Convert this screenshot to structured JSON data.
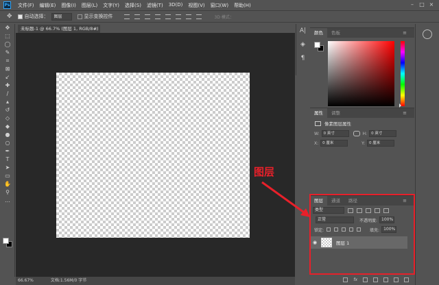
{
  "app": {
    "logo": "Ps"
  },
  "menu": [
    "文件(F)",
    "编辑(E)",
    "图像(I)",
    "图层(L)",
    "文字(Y)",
    "选择(S)",
    "滤镜(T)",
    "3D(D)",
    "视图(V)",
    "窗口(W)",
    "帮助(H)"
  ],
  "options": {
    "auto_select_label": "自动选择：",
    "auto_select_value": "图层",
    "transform_label": "显示变换控件",
    "mode3d": "3D 模式："
  },
  "document": {
    "tab_title": "未标题-1 @ 66.7% (图层 1, RGB/8#)",
    "zoom": "66.67%",
    "doc_info": "文档:1.56M/0 字节"
  },
  "color_panel": {
    "tabs": [
      "颜色",
      "色板"
    ],
    "foreground": "#ffffff",
    "background": "#000000",
    "hue": "#ff0000"
  },
  "properties_panel": {
    "tabs": [
      "属性",
      "调整"
    ],
    "heading": "像素图层属性",
    "w_label": "W:",
    "w_value": "0 英寸",
    "h_label": "H:",
    "h_value": "0 英寸",
    "x_label": "X:",
    "x_value": "0 厘米",
    "y_label": "Y:",
    "y_value": "0 厘米"
  },
  "layers_panel": {
    "tabs": [
      "图层",
      "通道",
      "路径"
    ],
    "kind_filter": "类型",
    "blend_mode": "正常",
    "opacity_label": "不透明度:",
    "opacity_value": "100%",
    "lock_label": "锁定:",
    "fill_label": "填充:",
    "fill_value": "100%",
    "layer_name": "图层 1"
  },
  "annotation": {
    "label": "图层",
    "color": "#e8202a"
  }
}
